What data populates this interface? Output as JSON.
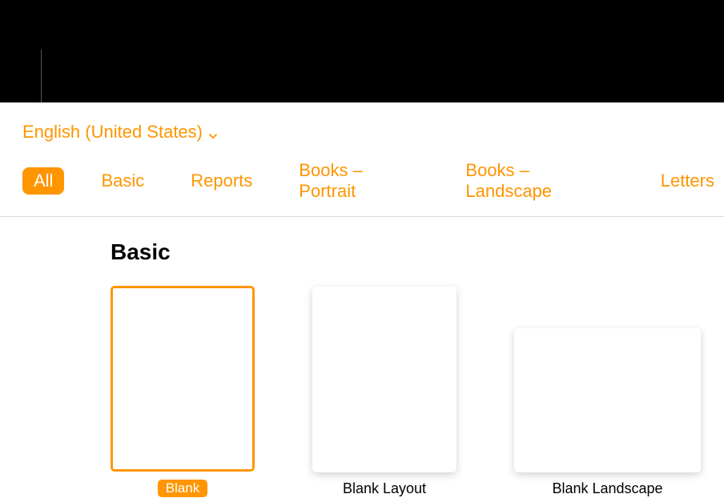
{
  "language": {
    "label": "English (United States)"
  },
  "tabs": {
    "all": "All",
    "basic": "Basic",
    "reports": "Reports",
    "books_portrait": "Books – Portrait",
    "books_landscape": "Books – Landscape",
    "letters": "Letters"
  },
  "section": {
    "title": "Basic"
  },
  "templates": {
    "blank": "Blank",
    "blank_layout": "Blank Layout",
    "blank_landscape": "Blank Landscape"
  }
}
